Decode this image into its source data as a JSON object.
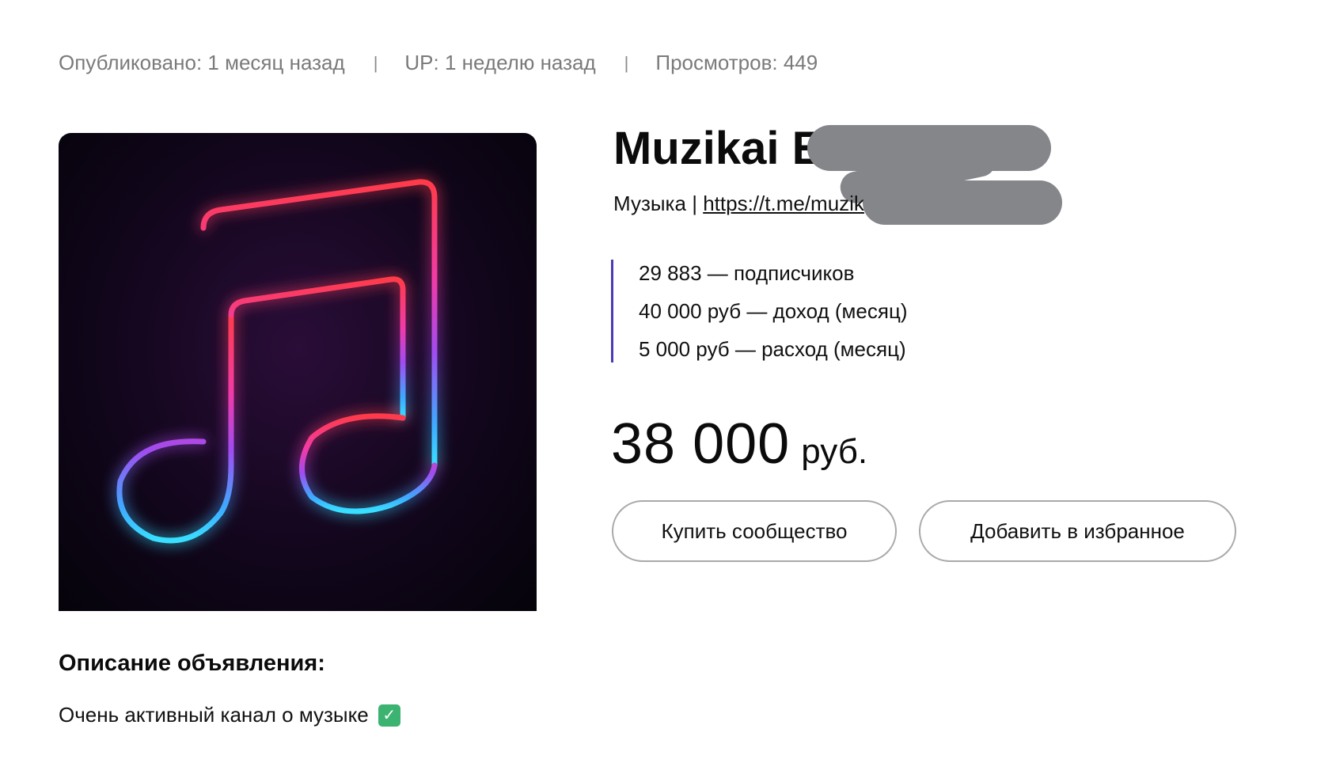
{
  "meta": {
    "published": "Опубликовано: 1 месяц назад",
    "separator": "|",
    "up": "UP: 1 неделю назад",
    "views": "Просмотров: 449"
  },
  "cover": {
    "icon": "music-note-icon"
  },
  "listing": {
    "title": "Muzikai E",
    "category": "Музыка",
    "divider": "|",
    "link": "https://t.me/muzik",
    "stats": [
      "29 883 — подписчиков",
      "40 000 руб — доход (месяц)",
      "5 000 руб — расход (месяц)"
    ],
    "price_amount": "38 000",
    "price_currency": "руб."
  },
  "actions": {
    "buy_label": "Купить сообщество",
    "favorite_label": "Добавить в избранное"
  },
  "description": {
    "heading": "Описание объявления:",
    "text": "Очень активный канал о музыке",
    "emoji": "check-mark-icon"
  },
  "colors": {
    "accent_bar": "#4b3bb5",
    "muted_text": "#7a7a7a",
    "redaction": "#85868a",
    "check_green": "#3cb371"
  }
}
